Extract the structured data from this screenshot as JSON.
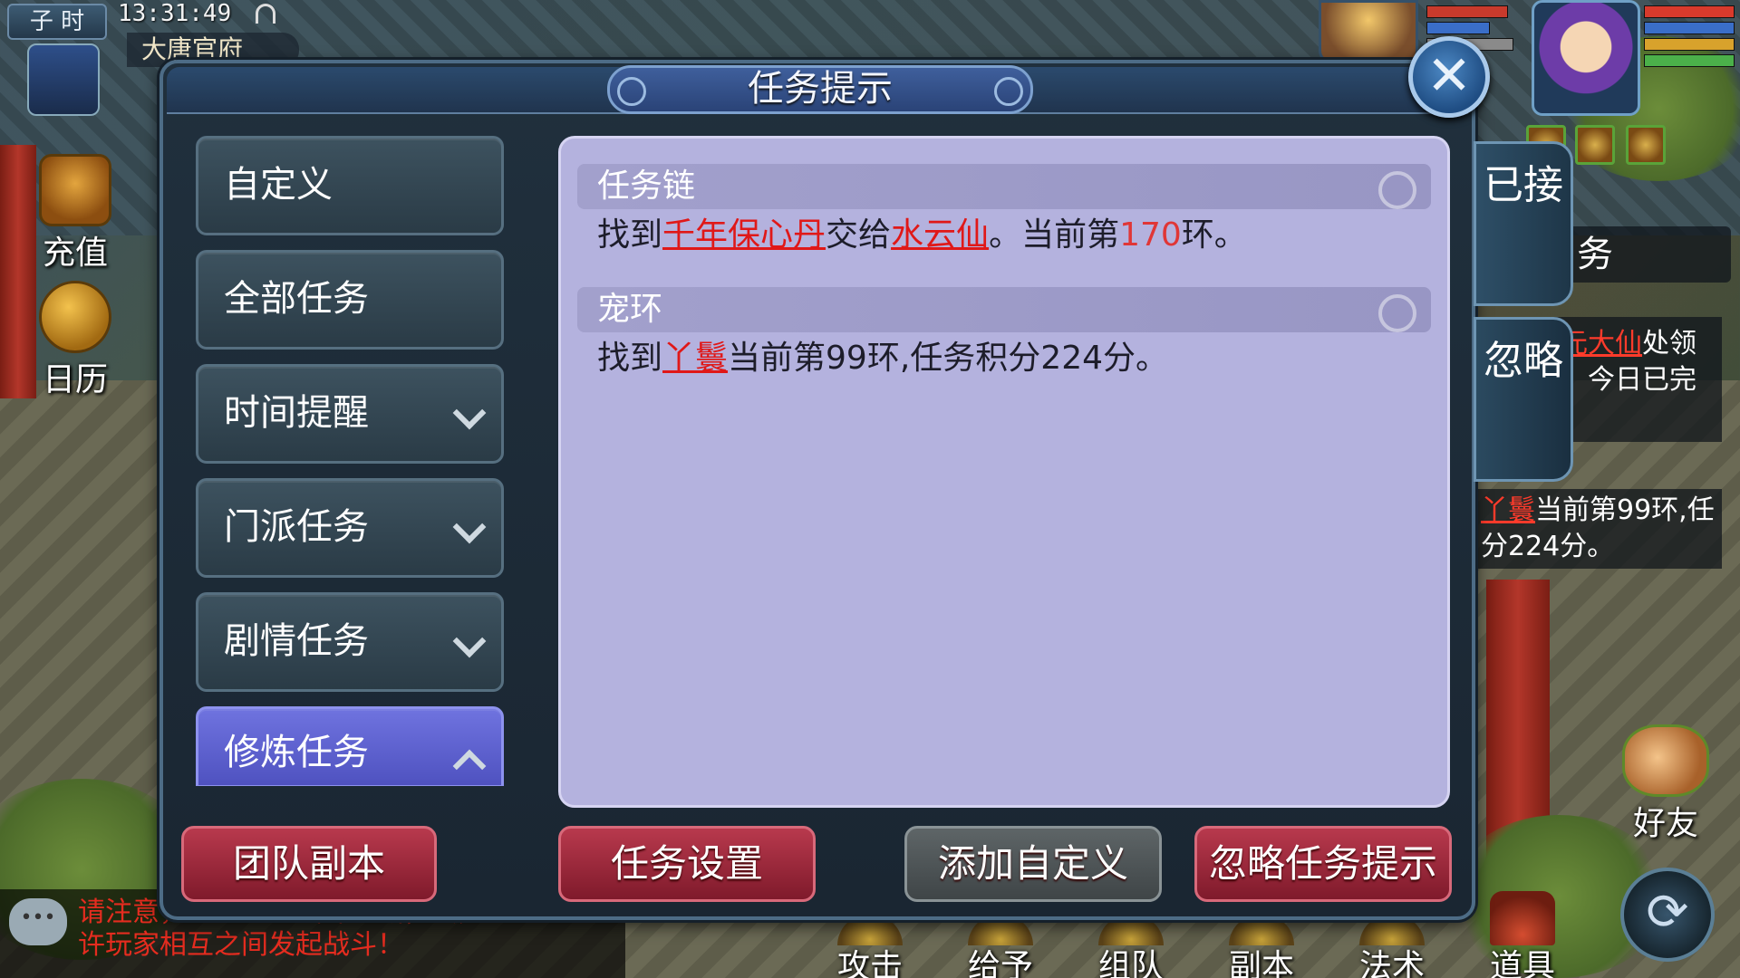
{
  "hud": {
    "period": "子 时",
    "clock": "13:31:49",
    "location": "大唐官府",
    "recharge_label": "充值",
    "calendar_label": "日历"
  },
  "dialog": {
    "title": "任务提示",
    "close_symbol": "✕",
    "categories": [
      {
        "label": "自定义",
        "expandable": false,
        "expanded": false
      },
      {
        "label": "全部任务",
        "expandable": false,
        "expanded": false
      },
      {
        "label": "时间提醒",
        "expandable": true,
        "expanded": false
      },
      {
        "label": "门派任务",
        "expandable": true,
        "expanded": false
      },
      {
        "label": "剧情任务",
        "expandable": true,
        "expanded": false
      },
      {
        "label": "修炼任务",
        "expandable": true,
        "expanded": true
      }
    ],
    "tasks": [
      {
        "header": "任务链",
        "parts": {
          "t1": "找到",
          "h1": "千年保心丹",
          "t2": "交给",
          "h2": "水云仙",
          "t3": "。当前第",
          "num": "170",
          "t4": "环。"
        }
      },
      {
        "header": "宠环",
        "parts": {
          "t1": "找到",
          "h1": "丫鬟",
          "t2": "当前第99环,任务积分224分。"
        }
      }
    ],
    "side_tabs": {
      "accepted": "已接",
      "ignore": "忽略"
    },
    "buttons": {
      "team_dungeon": "团队副本",
      "task_settings": "任务设置",
      "add_custom": "添加自定义",
      "ignore_hint": "忽略任务提示"
    }
  },
  "background_panels": {
    "quest_partial_1": {
      "name": "元大仙",
      "rest": "处领",
      "line2": "，今日已完"
    },
    "quest_partial_2": {
      "name": "丫鬟",
      "rest": "当前第99环,任",
      "line2": "分224分。"
    },
    "partial_tab": "务"
  },
  "right_hud": {
    "friend_label": "好友",
    "refresh_symbol": "⟳"
  },
  "chat": {
    "icon": "•••",
    "message": "请注意，您已进入战斗区域，会允许玩家相互之间发起战斗！",
    "visible_line1": "请注意，您已进入战斗区域，会允",
    "visible_line2": "许玩家相互之间发起战斗！"
  },
  "bottom_actions": [
    "攻击",
    "给予",
    "组队",
    "副本",
    "法术",
    "道具"
  ],
  "colors": {
    "dialog_bg": "#1a2632",
    "content_bg": "#b4b2de",
    "highlight_text": "#e01818",
    "active_category": "#5f62d0",
    "red_button": "#9e2a3c",
    "grey_button": "#4f5658"
  }
}
